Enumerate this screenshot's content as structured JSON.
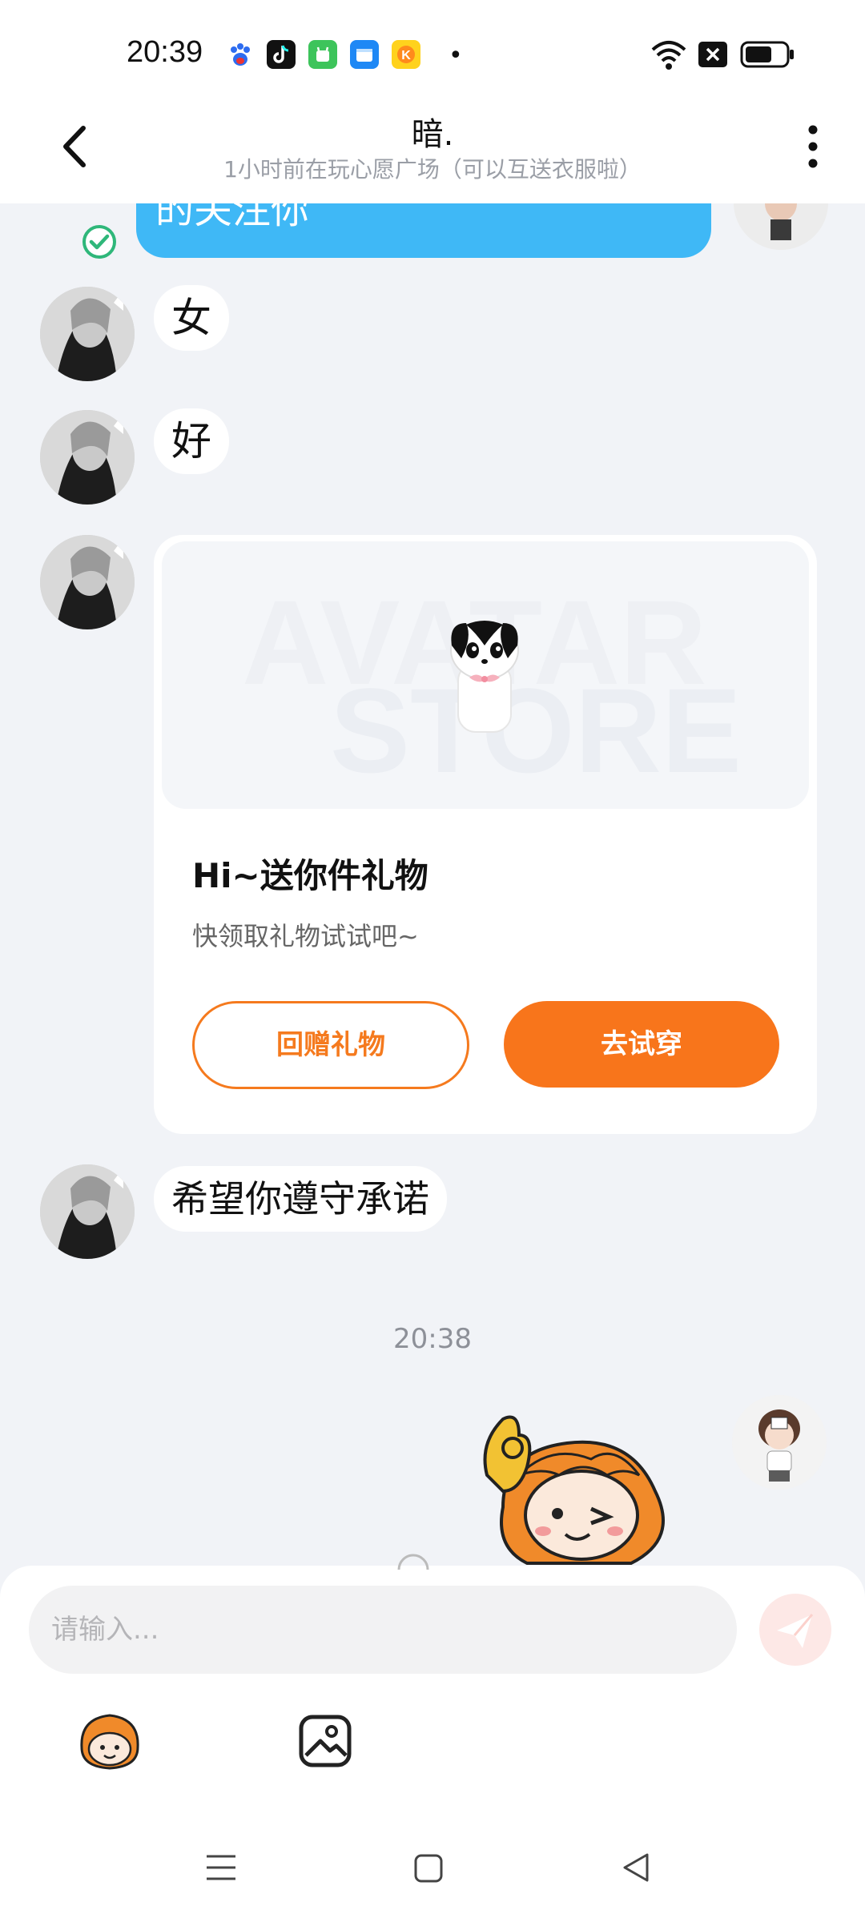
{
  "status_bar": {
    "time": "20:39",
    "dot": "•",
    "icons": [
      "baidu-icon",
      "tiktok-icon",
      "app-store-green-icon",
      "files-icon",
      "kuwo-music-icon",
      "wifi-icon",
      "close-notification-icon",
      "battery-icon"
    ]
  },
  "header": {
    "title": "暗.",
    "subtitle": "1小时前在玩心愿广场（可以互送衣服啦）",
    "back_icon": "chevron-left-icon",
    "more_icon": "more-vertical-icon"
  },
  "messages": {
    "sent_partial_text": "的关注你",
    "msg1": "女",
    "msg2": "好",
    "gift_card": {
      "watermark_line1": "AVATAR",
      "watermark_line2": "STORE",
      "title": "Hi~送你件礼物",
      "subtitle": "快领取礼物试试吧~",
      "return_gift_label": "回赠礼物",
      "try_on_label": "去试穿"
    },
    "msg4": "希望你遵守承诺",
    "timestamp": "20:38"
  },
  "input_area": {
    "placeholder": "请输入...",
    "send_icon": "paper-plane-icon",
    "tools": [
      "emoji-sticker-icon",
      "image-icon"
    ]
  },
  "colors": {
    "accent_orange": "#f8751b",
    "bubble_blue": "#3fb8f6",
    "check_green": "#2fb77a",
    "background": "#f1f3f7"
  }
}
